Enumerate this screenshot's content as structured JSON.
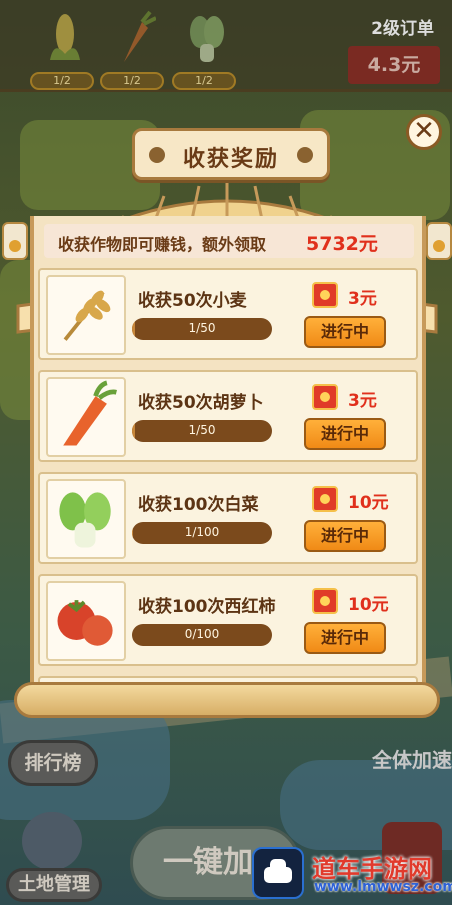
{
  "order": {
    "crops": [
      {
        "icon": "corn-icon",
        "count": "1/2"
      },
      {
        "icon": "carrot-icon",
        "count": "1/2"
      },
      {
        "icon": "cabbage-icon",
        "count": "1/2"
      }
    ],
    "level": "2级订单",
    "price": "4.3元"
  },
  "modal": {
    "title": "收获奖励",
    "close": "✕",
    "intro": "收获作物即可赚钱，额外领取",
    "intro_amount": "5732元",
    "tasks": [
      {
        "name": "收获50次小麦",
        "progress": "1/50",
        "fraction": 0.02,
        "reward": "3元",
        "button": "进行中",
        "icon": "wheat-icon"
      },
      {
        "name": "收获50次胡萝卜",
        "progress": "1/50",
        "fraction": 0.02,
        "reward": "3元",
        "button": "进行中",
        "icon": "carrot-icon"
      },
      {
        "name": "收获100次白菜",
        "progress": "1/100",
        "fraction": 0.01,
        "reward": "10元",
        "button": "进行中",
        "icon": "cabbage-icon"
      },
      {
        "name": "收获100次西红柿",
        "progress": "0/100",
        "fraction": 0,
        "reward": "10元",
        "button": "进行中",
        "icon": "tomato-icon"
      }
    ]
  },
  "side": {
    "rank": "排行榜",
    "land": "土地管理",
    "oneclick": "一键加",
    "speed": "全体加速"
  },
  "watermark": {
    "title": "道车手游网",
    "url": "www.lmwwsz.com"
  },
  "colors": {
    "reward_red": "#e0301c",
    "button_orange": "#f08a16",
    "panel_cream": "#f4e3c2",
    "progress_brown": "#7b4a1c"
  }
}
